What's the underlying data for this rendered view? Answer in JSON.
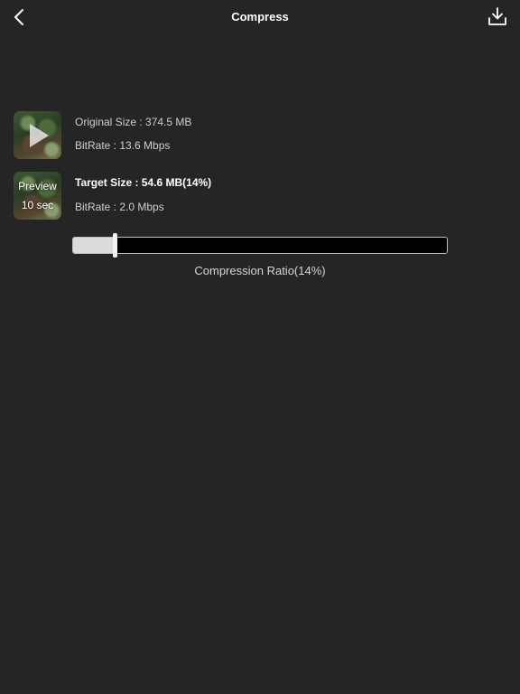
{
  "header": {
    "title": "Compress",
    "back_icon": "chevron-left-icon",
    "download_icon": "download-icon"
  },
  "original": {
    "size": "Original Size : 374.5 MB",
    "bitrate": "BitRate : 13.6 Mbps",
    "thumbnail_icon": "play-icon"
  },
  "target": {
    "size": "Target Size : 54.6 MB(14%)",
    "bitrate": "BitRate : 2.0 Mbps",
    "preview_label": "Preview",
    "preview_duration": "10 sec"
  },
  "compression": {
    "label": "Compression Ratio(14%)",
    "ratio": 0.11
  },
  "colors": {
    "background": "#252525",
    "slider_track": "#000000",
    "slider_fill": "#dcdcdc",
    "text_primary": "#ffffff"
  }
}
